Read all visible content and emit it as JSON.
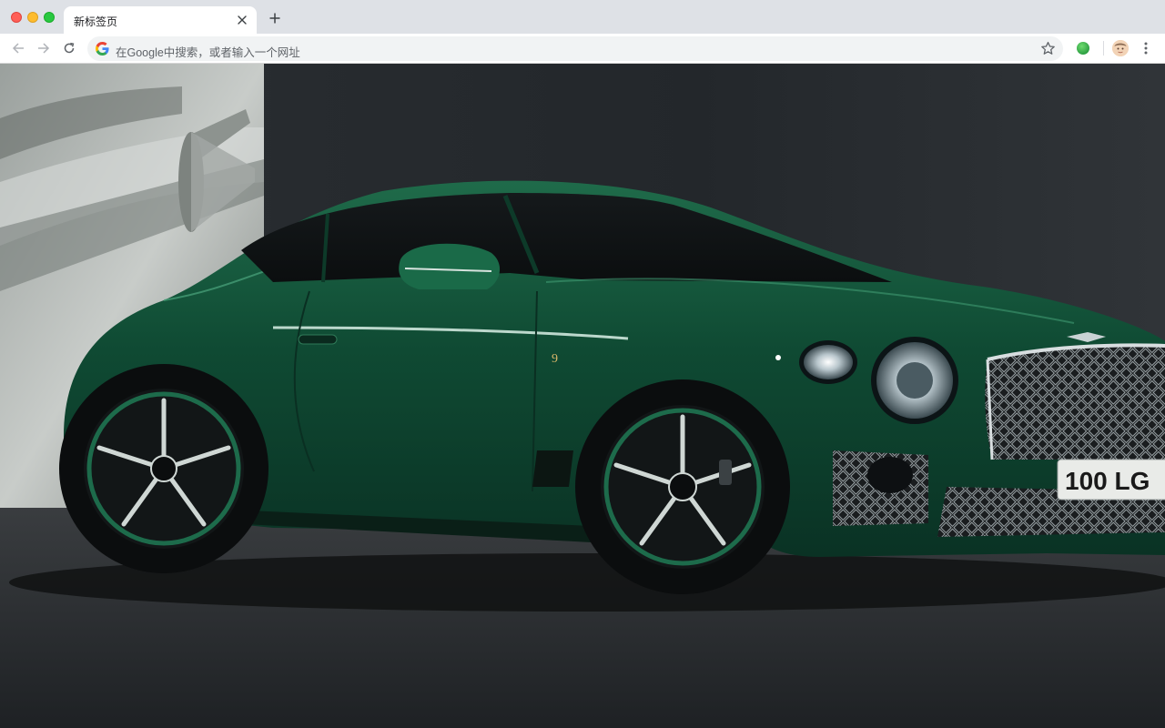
{
  "browser": {
    "tab": {
      "title": "新标签页",
      "close_icon": "close-icon"
    },
    "new_tab_icon": "plus-icon",
    "toolbar": {
      "back_icon": "arrow-left-icon",
      "forward_icon": "arrow-right-icon",
      "reload_icon": "reload-icon",
      "omnibox_placeholder": "在Google中搜索，或者输入一个网址",
      "bookmark_icon": "star-icon",
      "extension_icon": "green-circle-icon",
      "profile_icon": "avatar-icon",
      "menu_icon": "vertical-dots-icon"
    }
  },
  "wallpaper": {
    "subject": "green coupe",
    "license_plate": "100 LG",
    "badge": "9"
  },
  "colors": {
    "tabstrip": "#dee1e6",
    "toolbar": "#ffffff",
    "omnibox": "#f1f3f4",
    "car_green": "#0f4a33",
    "backdrop": "#2b2f33"
  }
}
